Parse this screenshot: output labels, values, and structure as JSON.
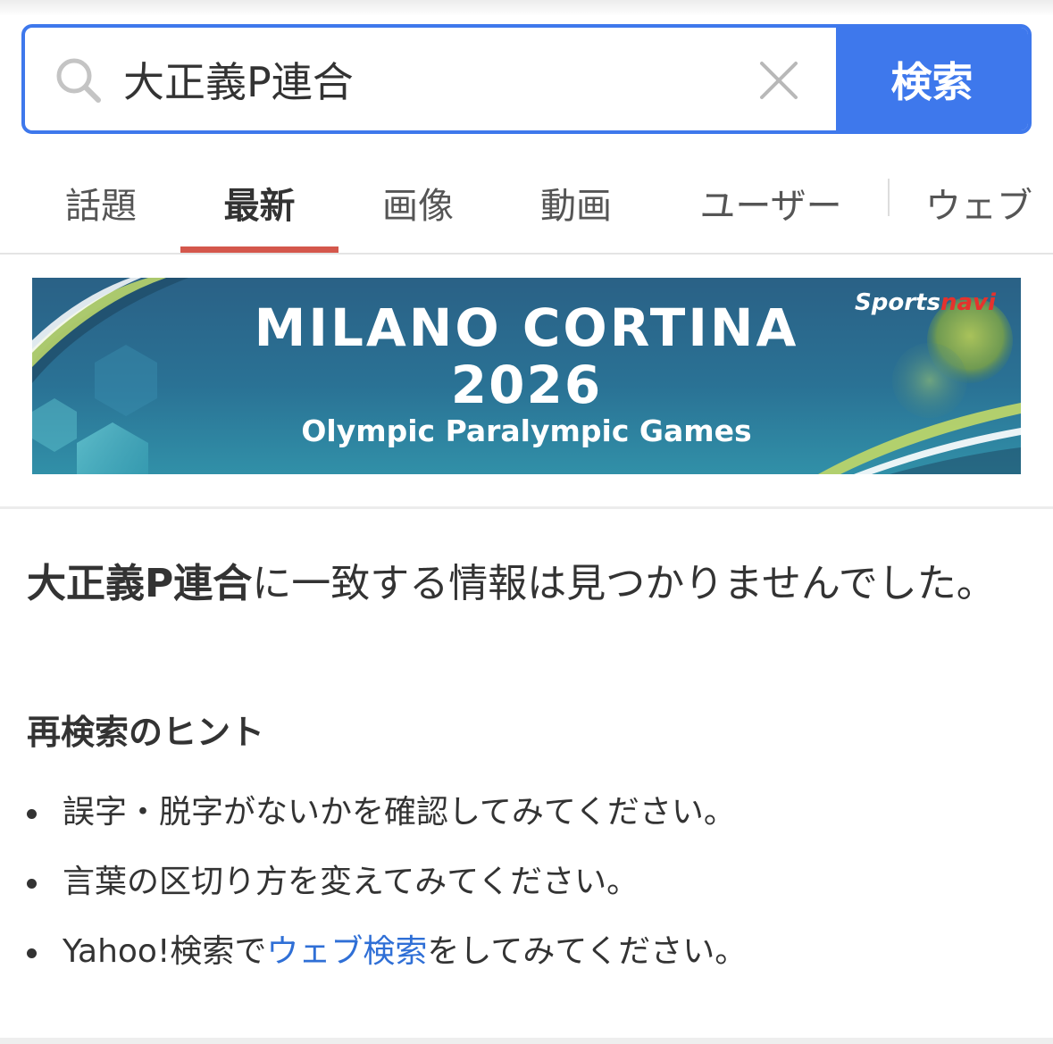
{
  "search": {
    "value": "大正義P連合",
    "button_label": "検索",
    "search_icon": "search-icon",
    "clear_icon": "close-icon"
  },
  "tabs": [
    {
      "label": "話題",
      "active": false
    },
    {
      "label": "最新",
      "active": true
    },
    {
      "label": "画像",
      "active": false
    },
    {
      "label": "動画",
      "active": false
    },
    {
      "label": "ユーザー",
      "active": false
    },
    {
      "label": "ウェブ",
      "active": false
    }
  ],
  "colors": {
    "accent": "#3e78ec",
    "active_tab_underline": "#d4574c",
    "link": "#2f6fd6"
  },
  "banner": {
    "title": "MILANO CORTINA",
    "year": "2026",
    "subtitle": "Olympic Paralympic Games",
    "brand_part1": "Sports",
    "brand_part2": "navi"
  },
  "result": {
    "query": "大正義P連合",
    "message": "に一致する情報は見つかりませんでした。"
  },
  "hints": {
    "title": "再検索のヒント",
    "items": [
      "誤字・脱字がないかを確認してみてください。",
      "言葉の区切り方を変えてみてください。"
    ],
    "web_item_prefix": "Yahoo!検索で",
    "web_item_link": "ウェブ検索",
    "web_item_suffix": "をしてみてください。"
  }
}
